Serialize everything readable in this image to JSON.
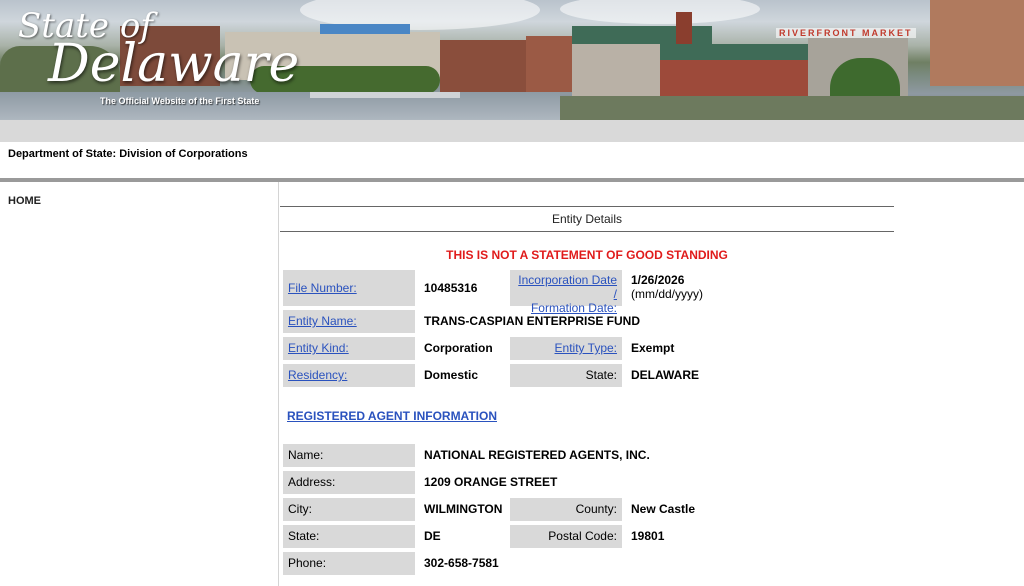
{
  "header": {
    "brand_state": "State of",
    "brand_delaware": "Delaware",
    "brand_tagline": "The Official Website of the First State",
    "market_sign": "RIVERFRONT MARKET"
  },
  "department": {
    "title": "Department of State: Division of Corporations"
  },
  "sidebar": {
    "home": "HOME"
  },
  "details": {
    "title": "Entity Details",
    "warning": "THIS IS NOT A STATEMENT OF GOOD STANDING",
    "file_number_label": "File Number:",
    "file_number": "10485316",
    "inc_date_label_1": "Incorporation Date /",
    "inc_date_label_2": "Formation Date:",
    "inc_date": "1/26/2026",
    "inc_date_format": "(mm/dd/yyyy)",
    "entity_name_label": "Entity Name:",
    "entity_name": "TRANS-CASPIAN ENTERPRISE FUND",
    "entity_kind_label": "Entity Kind:",
    "entity_kind": "Corporation",
    "entity_type_label": "Entity Type:",
    "entity_type": "Exempt",
    "residency_label": "Residency:",
    "residency": "Domestic",
    "state_label": "State:",
    "state": "DELAWARE"
  },
  "agent": {
    "section_title": "REGISTERED AGENT INFORMATION",
    "name_label": "Name:",
    "name": "NATIONAL REGISTERED AGENTS, INC.",
    "address_label": "Address:",
    "address": "1209 ORANGE STREET",
    "city_label": "City:",
    "city": "WILMINGTON",
    "county_label": "County:",
    "county": "New Castle",
    "state_label": "State:",
    "state": "DE",
    "postal_label": "Postal Code:",
    "postal": "19801",
    "phone_label": "Phone:",
    "phone": "302-658-7581"
  }
}
